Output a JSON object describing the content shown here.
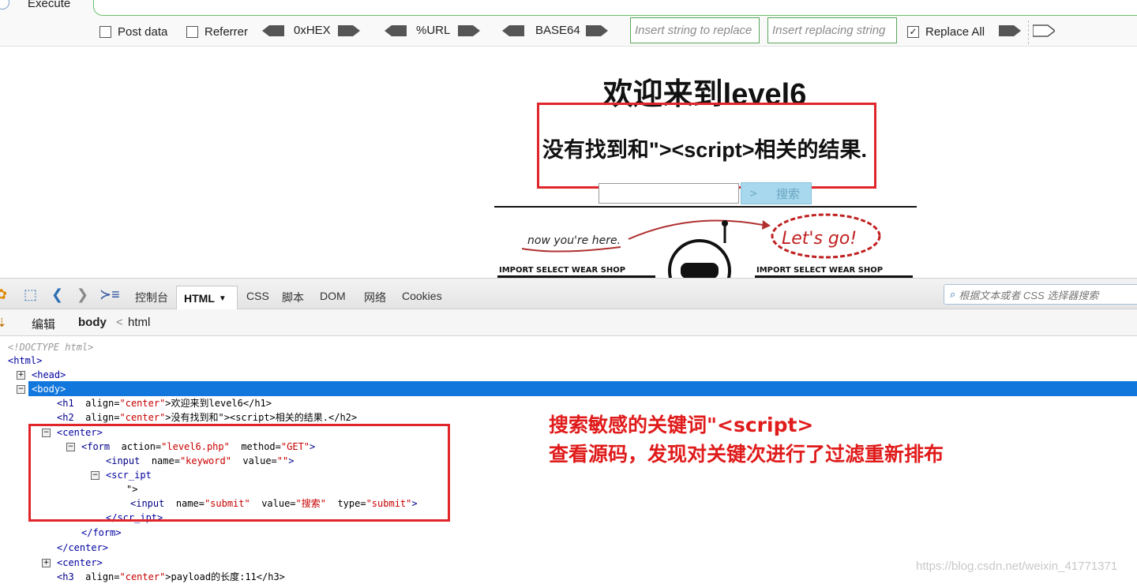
{
  "hackbar": {
    "execute_label": "Execute",
    "post_data_label": "Post data",
    "referrer_label": "Referrer",
    "hex_label": "0xHEX",
    "url_label": "%URL",
    "base64_label": "BASE64",
    "replace_placeholder": "Insert string to replace",
    "replacing_placeholder": "Insert replacing string",
    "replace_all_label": "Replace All",
    "replace_all_checked": "✓"
  },
  "page": {
    "h1": "欢迎来到level6",
    "h2": "没有找到和\"><script>相关的结果.",
    "submit_arrow": ">",
    "submit_label": "搜索",
    "banner_now": "now you're here.",
    "banner_lets_go": "Let's go!",
    "banner_shop_left": "IMPORT SELECT WEAR SHOP",
    "banner_shop_right": "IMPORT SELECT WEAR SHOP"
  },
  "devtools": {
    "tabs": [
      "控制台",
      "HTML",
      "CSS",
      "脚本",
      "DOM",
      "网络",
      "Cookies"
    ],
    "search_placeholder": "根据文本或者 CSS 选择器搜索",
    "breadcrumb": {
      "edit": "编辑",
      "body": "body",
      "sep": "<",
      "html": "html"
    },
    "tree": {
      "doctype": "<!DOCTYPE html>",
      "html": "<html>",
      "head": "<head>",
      "body": "<body>",
      "h1_tag": "<h1",
      "h1_attr": "align=",
      "h1_val": "\"center\"",
      "h1_text": ">欢迎来到level6</h1>",
      "h2_tag": "<h2",
      "h2_attr": "align=",
      "h2_val": "\"center\"",
      "h2_text": ">没有找到和\"><script>相关的结果.</h2>",
      "center": "<center>",
      "form_tag": "<form",
      "form_action_attr": "action=",
      "form_action_val": "\"level6.php\"",
      "form_method_attr": "method=",
      "form_method_val": "\"GET\"",
      "input1_tag": "<input",
      "input1_name_attr": "name=",
      "input1_name_val": "\"keyword\"",
      "input1_value_attr": "value=",
      "input1_value_val": "\"\"",
      "input1_close": ">",
      "scr_ipt": "<scr_ipt",
      "quote_line": "\">",
      "input2_tag": "<input",
      "input2_name_attr": "name=",
      "input2_name_val": "\"submit\"",
      "input2_value_attr": "value=",
      "input2_value_val": "\"搜索\"",
      "input2_type_attr": "type=",
      "input2_type_val": "\"submit\"",
      "input2_close": ">",
      "scr_ipt_close": "</scr_ipt>",
      "form_close": "</form>",
      "center_close": "</center>",
      "center2": "<center>",
      "h3_tag": "<h3",
      "h3_attr": "align=",
      "h3_val": "\"center\"",
      "h3_text": ">payload的长度:11</h3>"
    }
  },
  "annotation": {
    "line1": "搜索敏感的关键词\"<script>",
    "line2": "查看源码，发现对关键次进行了过滤重新排布"
  },
  "watermark": "https://blog.csdn.net/weixin_41771371",
  "colors": {
    "annotation_red": "#e01b1b",
    "selection_blue": "#1177dd",
    "accent_green": "#5aa65a"
  }
}
